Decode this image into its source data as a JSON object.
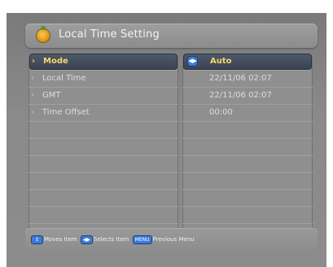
{
  "title": "Local Time Setting",
  "settings": [
    {
      "label": "Mode",
      "value": "Auto"
    },
    {
      "label": "Local Time",
      "value": "22/11/06 02:07"
    },
    {
      "label": "GMT",
      "value": "22/11/06 02:07"
    },
    {
      "label": "Time Offset",
      "value": "00:00"
    }
  ],
  "help": {
    "move_key": "↕",
    "move_text": "Moves Item",
    "select_key": "◀▶",
    "select_text": "Selects Item",
    "menu_key": "MENU",
    "menu_text": "Previous Menu"
  },
  "colors": {
    "selection": "#3f4857",
    "highlight_text": "#f6d66a",
    "accent_key": "#3a7cdc"
  }
}
